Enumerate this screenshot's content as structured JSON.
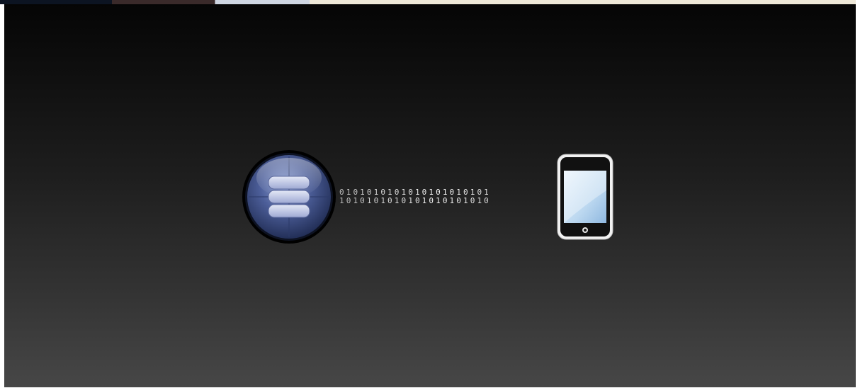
{
  "diagram": {
    "nodes": [
      {
        "id": "server",
        "icon": "database-server-icon"
      },
      {
        "id": "phone",
        "icon": "smartphone-icon"
      }
    ],
    "stream": {
      "line1": "0101010101010101010101",
      "line2": "1010101010101010101010"
    }
  },
  "colors": {
    "background_top": "#050505",
    "background_bottom": "#474747",
    "server_blue": "#3d4e86",
    "screen_blue": "#bcd8f0"
  }
}
